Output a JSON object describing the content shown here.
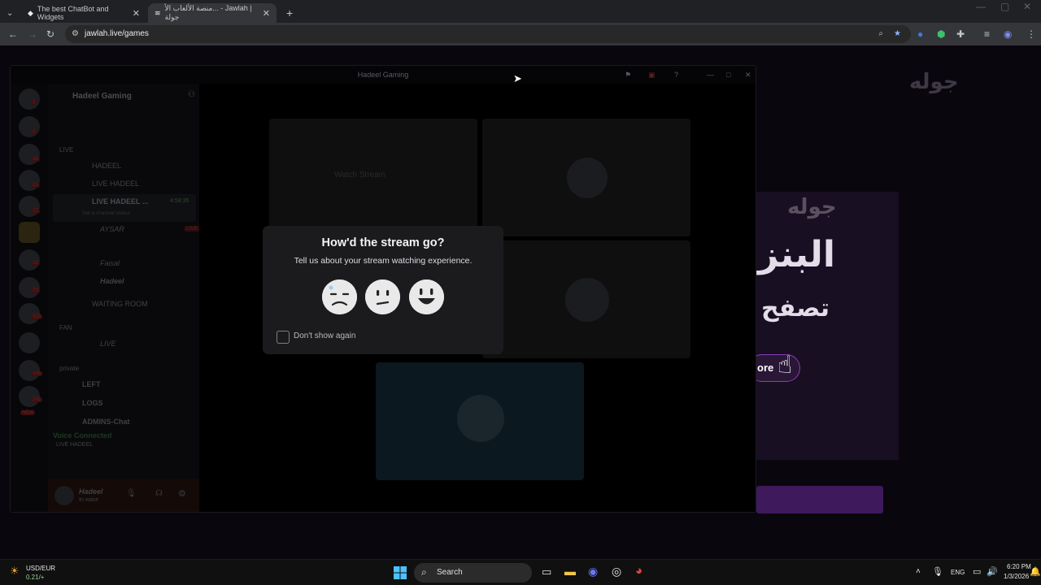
{
  "browser": {
    "tabs": [
      {
        "title": "The best ChatBot and Widgets",
        "close": "✕"
      },
      {
        "title": "منصة الألعاب الأ... - Jawlah | جولة",
        "close": "✕"
      }
    ],
    "new_tab": "+",
    "url": "jawlah.live/games"
  },
  "website": {
    "logo": "جوله",
    "banner_line1": "جوله",
    "banner_line2": "البنز",
    "banner_line3": "تصفح",
    "banner_button": "ore"
  },
  "discord": {
    "window_title": "Hadeel Gaming",
    "server_name": "Hadeel Gaming",
    "channels": [
      {
        "label": "LIVE",
        "kind": "category"
      },
      {
        "label": "HADEEL",
        "kind": "voice"
      },
      {
        "label": "LIVE HADEEL",
        "kind": "voice"
      },
      {
        "label": "LIVE HADEEL ...",
        "kind": "voice",
        "time": "4:58:35"
      },
      {
        "label": "Set a channel status",
        "kind": "status"
      },
      {
        "label": "AYSAR",
        "kind": "user",
        "badge": "LIVE"
      },
      {
        "label": "Faisal",
        "kind": "user"
      },
      {
        "label": "Hadeel",
        "kind": "user"
      },
      {
        "label": "WAITING ROOM",
        "kind": "voice"
      },
      {
        "label": "FAN",
        "kind": "category"
      },
      {
        "label": "LIVE",
        "kind": "voice"
      },
      {
        "label": "private",
        "kind": "category"
      },
      {
        "label": "LEFT",
        "kind": "text"
      },
      {
        "label": "LOGS",
        "kind": "text"
      },
      {
        "label": "ADMINS-Chat",
        "kind": "text"
      }
    ],
    "voice_status": "Voice Connected",
    "voice_channel": "LIVE HADEEL",
    "user_name": "Hadeel",
    "user_status": "In voice",
    "watch_stream": "Watch Stream",
    "guild_badges": [
      "2",
      "2",
      "19",
      "21",
      "77",
      "33",
      "70",
      "329",
      "166",
      "202",
      "NEW"
    ]
  },
  "modal": {
    "title": "How'd the stream go?",
    "subtitle": "Tell us about your stream watching experience.",
    "ratings": [
      "sad-face-icon",
      "neutral-face-icon",
      "happy-face-icon"
    ],
    "checkbox_label": "Don't show again",
    "checked": false
  },
  "taskbar": {
    "weather_title": "USD/EUR",
    "weather_value": "0.21/+",
    "search_label": "Search",
    "lang": "ENG",
    "time": "6:20 PM",
    "date": "1/3/2026"
  }
}
